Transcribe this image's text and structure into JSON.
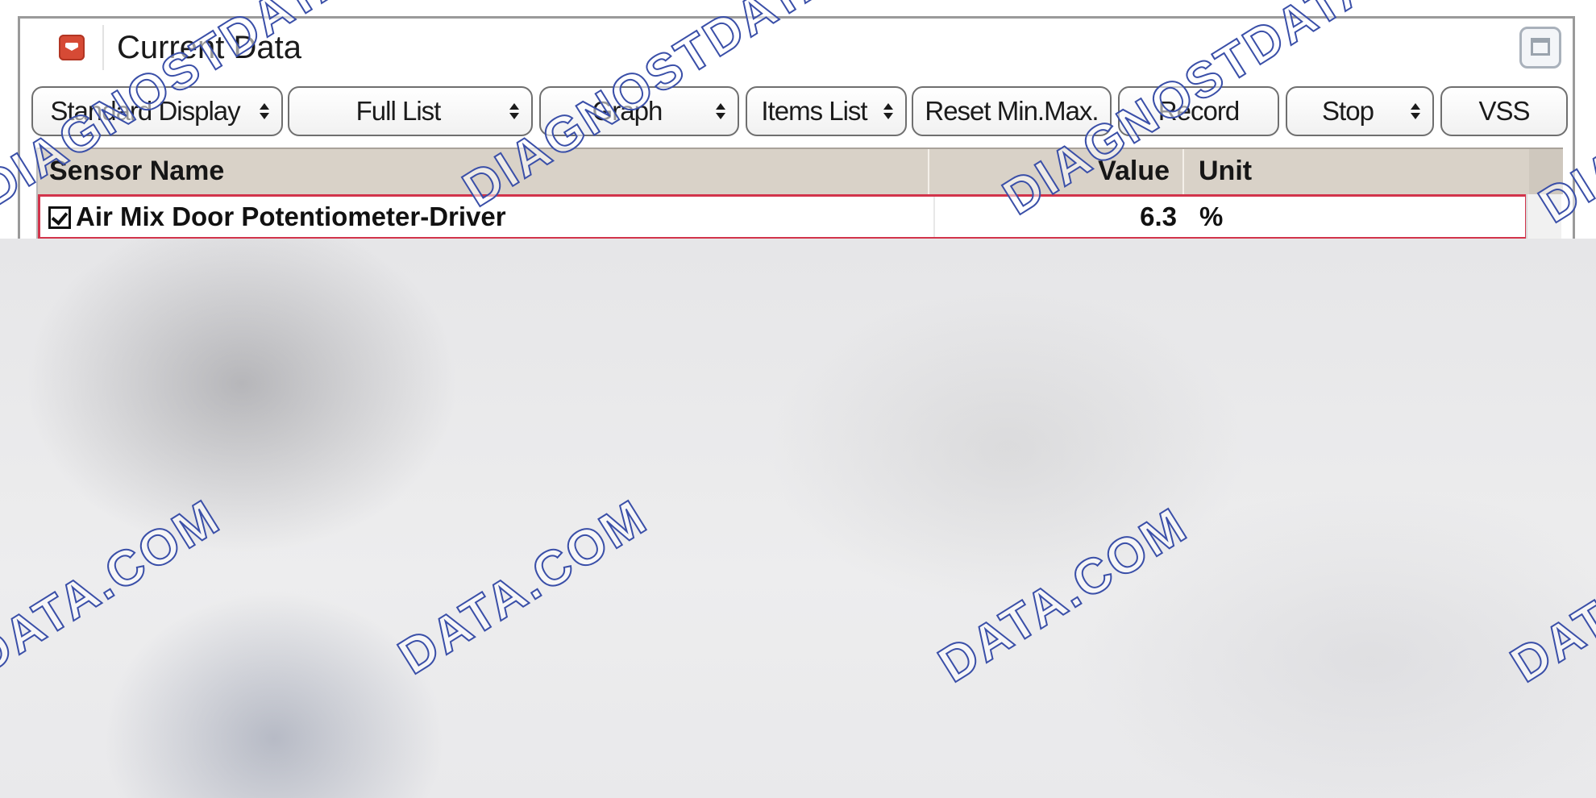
{
  "panel": {
    "title": "Current Data"
  },
  "toolbar": {
    "buttons": [
      {
        "label": "Standard Display",
        "has_dropdown": true
      },
      {
        "label": "Full List",
        "has_dropdown": true
      },
      {
        "label": "Graph",
        "has_dropdown": true
      },
      {
        "label": "Items List",
        "has_dropdown": true
      },
      {
        "label": "Reset Min.Max.",
        "has_dropdown": false
      },
      {
        "label": "Record",
        "has_dropdown": false
      },
      {
        "label": "Stop",
        "has_dropdown": true
      },
      {
        "label": "VSS",
        "has_dropdown": false
      }
    ]
  },
  "table": {
    "columns": [
      "Sensor Name",
      "Value",
      "Unit"
    ],
    "rows": [
      {
        "checked": true,
        "name": "Air Mix Door Potentiometer-Driver",
        "value": "6.3",
        "unit": "%"
      }
    ]
  },
  "watermark": {
    "text_a": "DIAGNOSTDATA.",
    "text_b": "DATA.COM",
    "stroke_color": "#3a4fa8"
  },
  "colors": {
    "accent_red": "#d64a35",
    "row_highlight_border": "#d2344b",
    "header_bg": "#d9d2c8"
  }
}
